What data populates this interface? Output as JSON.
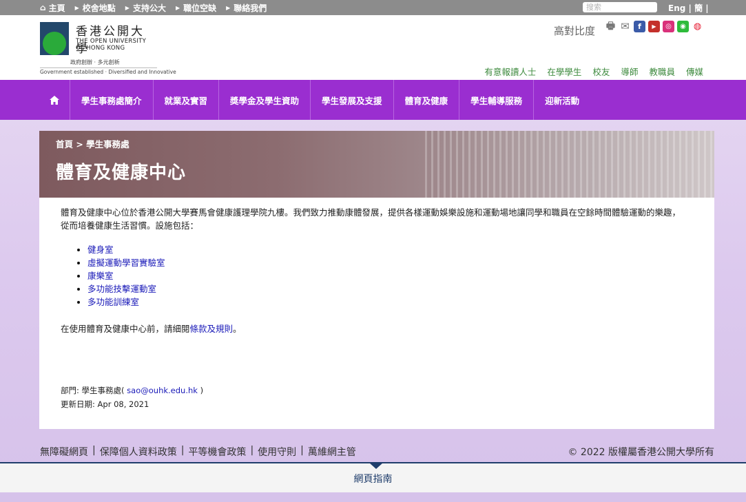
{
  "topnav": {
    "home": "主頁",
    "items": [
      "校舍地點",
      "支持公大",
      "職位空缺",
      "聯絡我們"
    ]
  },
  "search": {
    "placeholder": "搜索"
  },
  "lang": "Eng | 簡 |",
  "logo": {
    "zh": "香港公開大學",
    "en_line1": "THE OPEN UNIVERSITY",
    "en_line2": "OF HONG KONG",
    "motto_zh": "政府創辦 · 多元創新",
    "motto_en": "Government established · Diversified and Innovative"
  },
  "contrast": "高對比度",
  "audience": [
    "有意報讀人士",
    "在學學生",
    "校友",
    "導師",
    "教職員",
    "傳媒"
  ],
  "mainnav": [
    "學生事務處簡介",
    "就業及實習",
    "獎學金及學生資助",
    "學生發展及支援",
    "體育及健康",
    "學生輔導服務",
    "迎新活動"
  ],
  "breadcrumb": "首頁 > 學生事務處",
  "page_title": "體育及健康中心",
  "intro": "體育及健康中心位於香港公開大學賽馬會健康護理學院九樓。我們致力推動康體發展，提供各樣運動娛樂設施和運動場地讓同學和職員在空餘時間體驗運動的樂趣，從而培養健康生活習慣。設施包括：",
  "facilities": [
    "健身室",
    "虛擬運動學習實驗室",
    "康樂室",
    "多功能技擊運動室",
    "多功能訓練室"
  ],
  "rules": {
    "prefix": "在使用體育及健康中心前，請細閱",
    "link": "條款及規則",
    "suffix": "。"
  },
  "dept": {
    "prefix": "部門: 學生事務處( ",
    "email": "sao@ouhk.edu.hk",
    "suffix": " )"
  },
  "updated": "更新日期: Apr 08, 2021",
  "footer": {
    "links": [
      "無障礙網頁",
      "保障個人資料政策",
      "平等機會政策",
      "使用守則",
      "萬維網主管"
    ],
    "copyright": "© 2022 版權屬香港公開大學所有",
    "sitemap": "網頁指南"
  },
  "colors": {
    "nav_purple": "#9a2ed0",
    "audience_green": "#3e8a3e",
    "link_blue": "#1a1ab8",
    "sitemap_navy": "#1f3d6b"
  }
}
